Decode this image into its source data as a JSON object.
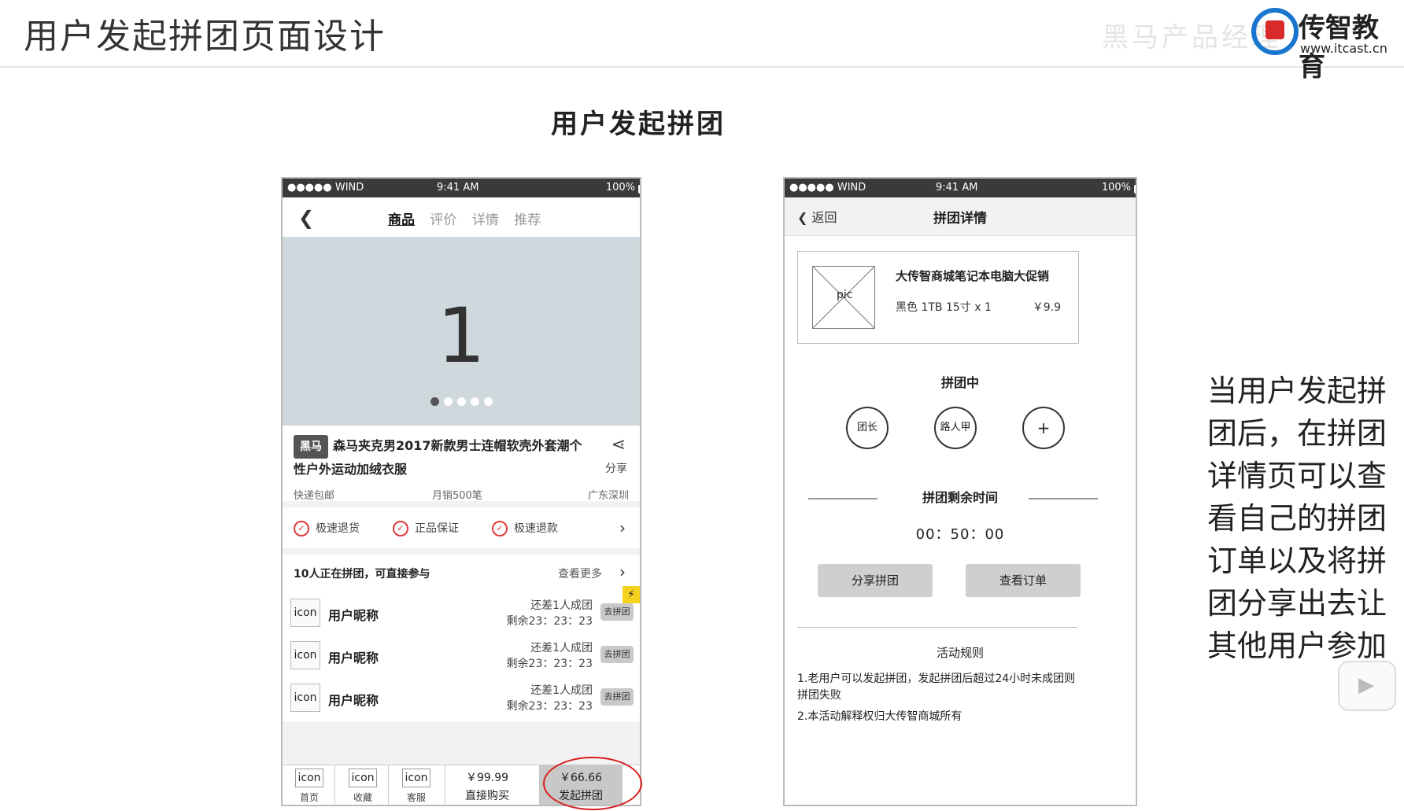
{
  "header": {
    "title": "用户发起拼团页面设计",
    "watermark": "黑马产品经理",
    "logo_text": "传智教育",
    "logo_url": "www.itcast.cn"
  },
  "section_title": "用户发起拼团",
  "side_text": "当用户发起拼团后，在拼团详情页可以查看自己的拼团订单以及将拼团分享出去让其他用户参加",
  "phone1": {
    "status": {
      "carrier": "●●●●● WIND",
      "time": "9:41 AM",
      "battery": "100%"
    },
    "tabs": [
      "商品",
      "评价",
      "详情",
      "推荐"
    ],
    "active_tab": "商品",
    "banner_number": "1",
    "brand_tag": "黑马",
    "product_title": "森马夹克男2017新款男士连帽软壳外套潮个性户外运动加绒衣服",
    "share_label": "分享",
    "meta": {
      "shipping": "快递包邮",
      "sales": "月销500笔",
      "location": "广东深圳"
    },
    "guarantees": [
      "极速退货",
      "正品保证",
      "极速退款"
    ],
    "group_heading": "10人正在拼团，可直接参与",
    "more_label": "查看更多",
    "groups": [
      {
        "avatar": "icon",
        "nickname": "用户昵称",
        "need": "还差1人成团",
        "remain": "剩余23：23：23",
        "action": "去拼团"
      },
      {
        "avatar": "icon",
        "nickname": "用户昵称",
        "need": "还差1人成团",
        "remain": "剩余23：23：23",
        "action": "去拼团"
      },
      {
        "avatar": "icon",
        "nickname": "用户昵称",
        "need": "还差1人成团",
        "remain": "剩余23：23：23",
        "action": "去拼团"
      }
    ],
    "bottom": {
      "icons": [
        {
          "icon": "icon",
          "label": "首页"
        },
        {
          "icon": "icon",
          "label": "收藏"
        },
        {
          "icon": "icon",
          "label": "客服"
        }
      ],
      "direct_price": "￥99.99",
      "direct_label": "直接购买",
      "group_price": "￥66.66",
      "group_label": "发起拼团"
    }
  },
  "phone2": {
    "status": {
      "carrier": "●●●●● WIND",
      "time": "9:41 AM",
      "battery": "100%"
    },
    "back_label": "返回",
    "nav_title": "拼团详情",
    "order": {
      "pic_label": "pic",
      "title": "大传智商城笔记本电脑大促销",
      "spec": "黑色 1TB 15寸  x  1",
      "price": "￥9.9"
    },
    "status_title": "拼团中",
    "members": [
      "团长",
      "路人甲",
      "+"
    ],
    "time_title": "拼团剩余时间",
    "timer": "00：50：00",
    "buttons": [
      "分享拼团",
      "查看订单"
    ],
    "rules_title": "活动规则",
    "rules": [
      "1.老用户可以发起拼团，发起拼团后超过24小时未成团则拼团失败",
      "2.本活动解释权归大传智商城所有"
    ]
  },
  "colors": {
    "highlight_circle": "#d81e1e",
    "banner_bg": "#cfd8dc",
    "logo_blue": "#1a75cf"
  }
}
